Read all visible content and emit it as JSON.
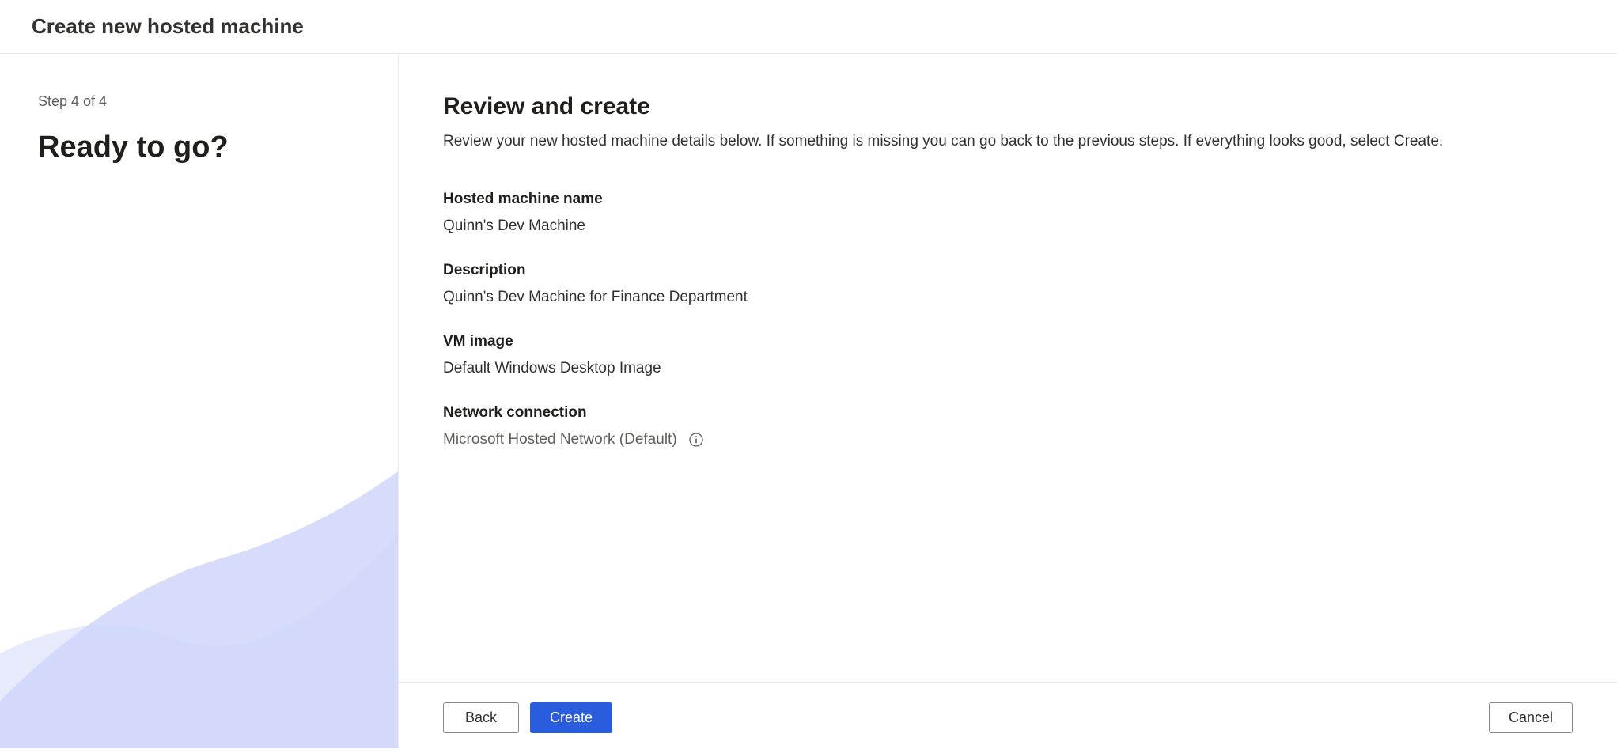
{
  "header": {
    "title": "Create new hosted machine"
  },
  "sidebar": {
    "step_indicator": "Step 4 of 4",
    "heading": "Ready to go?"
  },
  "main": {
    "title": "Review and create",
    "subtitle": "Review your new hosted machine details below. If something is missing you can go back to the previous steps. If everything looks good, select Create.",
    "fields": [
      {
        "label": "Hosted machine name",
        "value": "Quinn's Dev Machine",
        "inactive": false,
        "has_info": false
      },
      {
        "label": "Description",
        "value": "Quinn's Dev Machine for Finance Department",
        "inactive": false,
        "has_info": false
      },
      {
        "label": "VM image",
        "value": "Default Windows Desktop Image",
        "inactive": false,
        "has_info": false
      },
      {
        "label": "Network connection",
        "value": "Microsoft Hosted Network (Default)",
        "inactive": true,
        "has_info": true
      }
    ]
  },
  "footer": {
    "back_label": "Back",
    "create_label": "Create",
    "cancel_label": "Cancel"
  }
}
